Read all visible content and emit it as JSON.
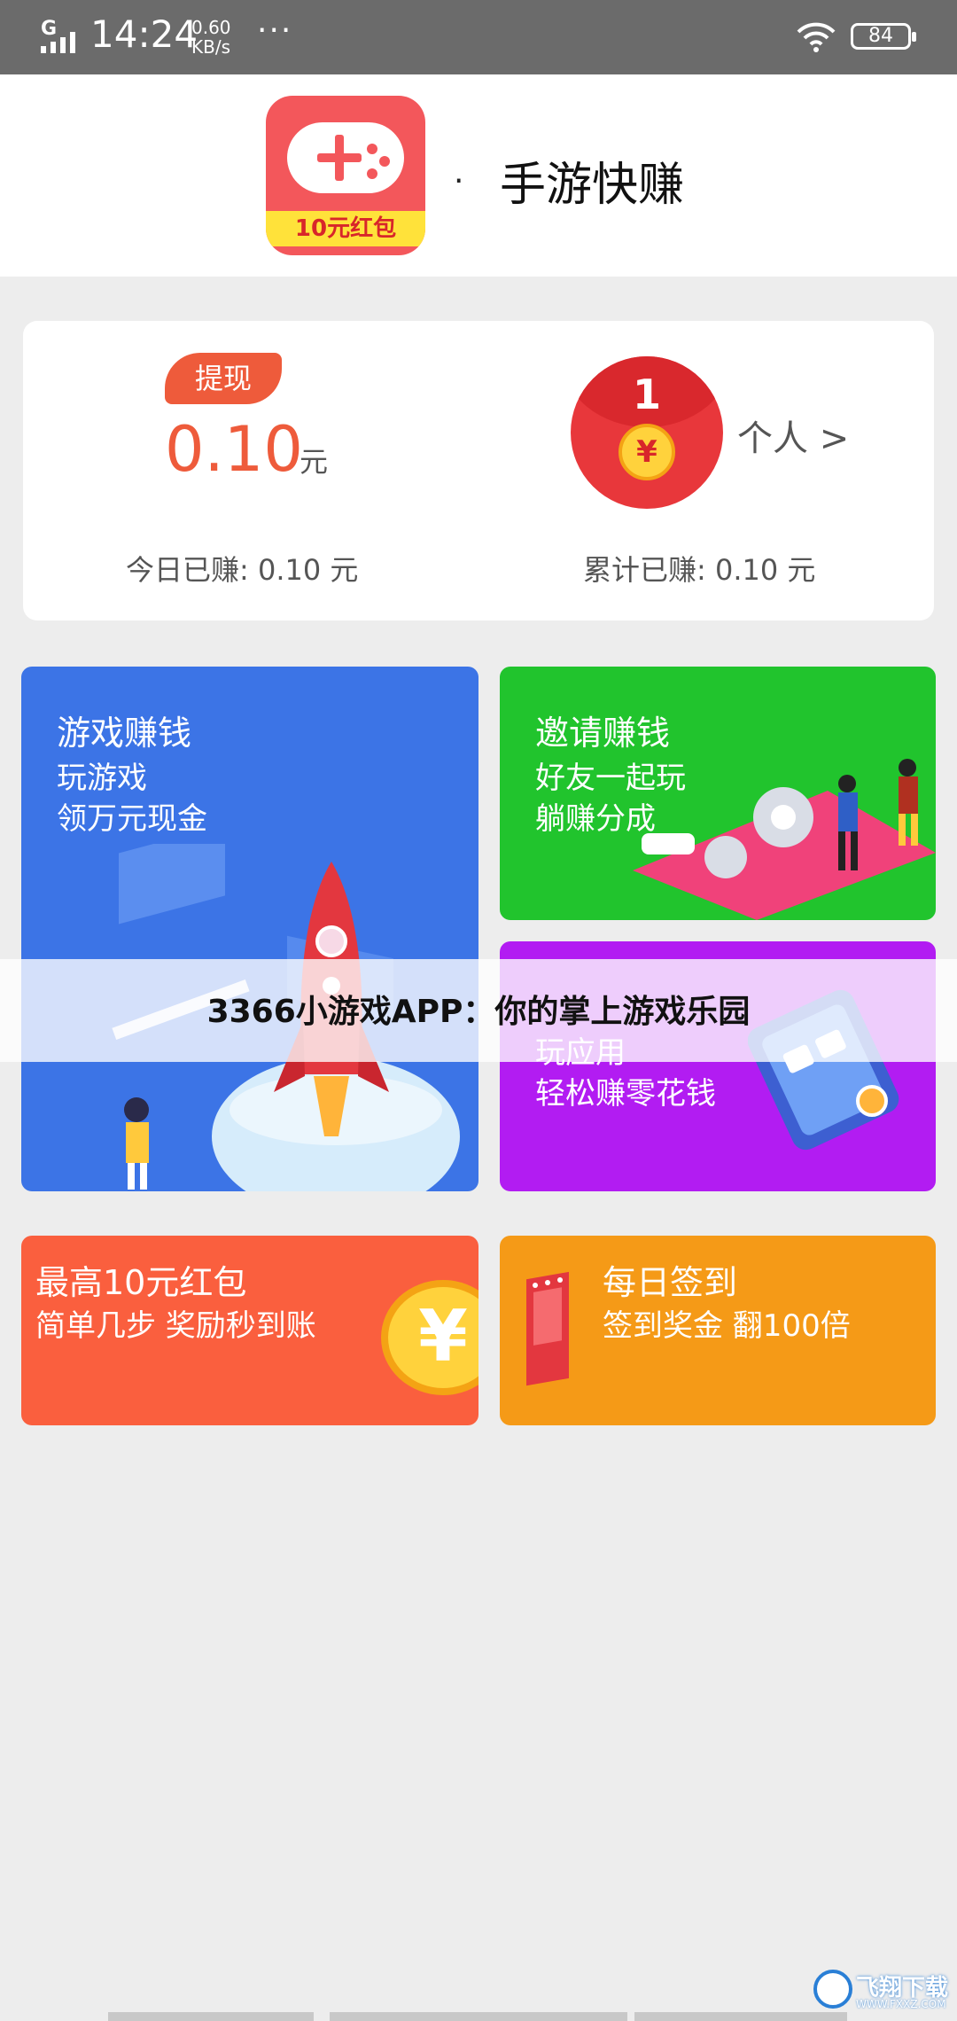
{
  "status_bar": {
    "network": "G",
    "time": "14:24",
    "speed_value": "0.60",
    "speed_unit": "KB/s",
    "dots": "···",
    "battery": "84"
  },
  "header": {
    "app_icon_badge": "10元红包",
    "dot": "·",
    "app_name": "手游快赚"
  },
  "earnings": {
    "withdraw_label": "提现",
    "balance": "0.10",
    "balance_unit": "元",
    "today_label": "今日已赚: 0.10 元",
    "redpack_digit": "1",
    "coin_symbol": "¥",
    "personal_link": "个人 >",
    "total_label": "累计已赚: 0.10 元"
  },
  "tiles": {
    "game": {
      "title": "游戏赚钱",
      "line1": "玩游戏",
      "line2": "领万元现金"
    },
    "invite": {
      "title": "邀请赚钱",
      "line1": "好友一起玩",
      "line2": "躺赚分成"
    },
    "app": {
      "line1": "玩应用",
      "line2": "轻松赚零花钱"
    },
    "red": {
      "title": "最高10元红包",
      "line1": "简单几步 奖励秒到账",
      "coin_symbol": "¥"
    },
    "sign": {
      "title": "每日签到",
      "line1": "签到奖金 翻100倍"
    }
  },
  "overlay_caption": "3366小游戏APP：你的掌上游戏乐园",
  "watermark": {
    "text": "飞翔下载",
    "url": "WWW.FXXZ.COM"
  },
  "colors": {
    "accent_orange": "#ee5b3b",
    "game_tile": "#3c74e6",
    "invite_tile": "#21c42d",
    "app_tile": "#b21cf2",
    "red_tile": "#fa5f3e",
    "sign_tile": "#f59a17"
  }
}
